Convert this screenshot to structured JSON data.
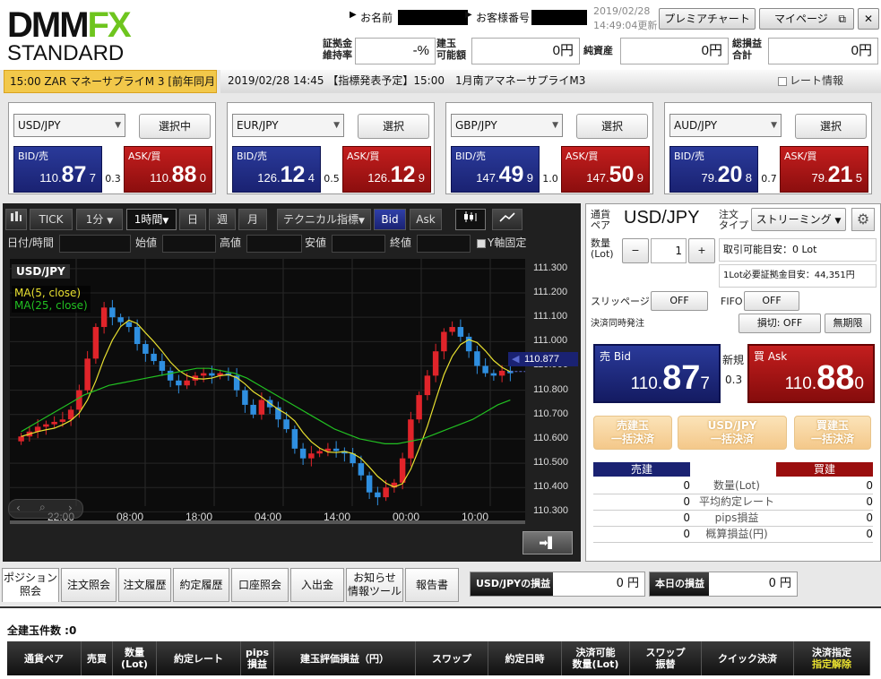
{
  "header": {
    "logo_main": "DMM",
    "logo_accent": "FX",
    "logo_sub": "STANDARD",
    "name_label": "お名前",
    "customer_no_label": "お客様番号",
    "updated_date": "2019/02/28",
    "updated_time": "14:49:04更新",
    "premier_chart": "プレミアチャート",
    "mypage": "マイページ",
    "close": "✕",
    "margin_ratio_label": "証拠金\n維持率",
    "margin_ratio_value": "-%",
    "available_label": "建玉\n可能額",
    "available_value": "0円",
    "net_assets_label": "純資産",
    "net_assets_value": "0円",
    "total_pl_label": "総損益\n合計",
    "total_pl_value": "0円"
  },
  "ticker": {
    "left_text": "15:00  ZAR  マネーサプライM 3 [前年同月",
    "right_text": "2019/02/28 14:45 【指標発表予定】15:00　1月南アマネーサプライM3",
    "rate_info_label": "レート情報"
  },
  "rate_panels": [
    {
      "pair": "USD/JPY",
      "button": "選択中",
      "bid_label": "BID/売",
      "ask_label": "ASK/買",
      "bid_a": "110.",
      "bid_b": "87",
      "bid_c": "7",
      "ask_a": "110.",
      "ask_b": "88",
      "ask_c": "0",
      "spread": "0.3"
    },
    {
      "pair": "EUR/JPY",
      "button": "選択",
      "bid_label": "BID/売",
      "ask_label": "ASK/買",
      "bid_a": "126.",
      "bid_b": "12",
      "bid_c": "4",
      "ask_a": "126.",
      "ask_b": "12",
      "ask_c": "9",
      "spread": "0.5"
    },
    {
      "pair": "GBP/JPY",
      "button": "選択",
      "bid_label": "BID/売",
      "ask_label": "ASK/買",
      "bid_a": "147.",
      "bid_b": "49",
      "bid_c": "9",
      "ask_a": "147.",
      "ask_b": "50",
      "ask_c": "9",
      "spread": "1.0"
    },
    {
      "pair": "AUD/JPY",
      "button": "選択",
      "bid_label": "BID/売",
      "ask_label": "ASK/買",
      "bid_a": "79.",
      "bid_b": "20",
      "bid_c": "8",
      "ask_a": "79.",
      "ask_b": "21",
      "ask_c": "5",
      "spread": "0.7"
    }
  ],
  "chart_toolbar": {
    "tick": "TICK",
    "interval1": "1分",
    "interval2": "1時間",
    "day": "日",
    "week": "週",
    "month": "月",
    "technical": "テクニカル指標",
    "bid": "Bid",
    "ask": "Ask"
  },
  "chart_inputs": {
    "datetime": "日付/時間",
    "open": "始値",
    "high": "高値",
    "low": "安値",
    "close": "終値",
    "yfix": "Y軸固定"
  },
  "chart_data": {
    "type": "candlestick",
    "pair_label": "USD/JPY",
    "ma5_label": "MA(5, close)",
    "ma25_label": "MA(25, close)",
    "current_price": "110.877",
    "ylim": [
      110.25,
      111.34
    ],
    "yticks": [
      "111.300",
      "111.200",
      "111.100",
      "111.000",
      "110.900",
      "110.800",
      "110.700",
      "110.600",
      "110.500",
      "110.400",
      "110.300"
    ],
    "xticks": [
      "22:00",
      "08:00",
      "18:00",
      "04:00",
      "14:00",
      "00:00",
      "10:00"
    ],
    "colors": {
      "up": "#e0242a",
      "down": "#2f8fe0",
      "ma5": "#e8e030",
      "ma25": "#22c022"
    },
    "closes": [
      110.61,
      110.63,
      110.65,
      110.66,
      110.67,
      110.68,
      110.72,
      110.8,
      110.93,
      111.06,
      111.14,
      111.1,
      111.08,
      111.06,
      110.99,
      110.95,
      110.92,
      110.88,
      110.84,
      110.82,
      110.84,
      110.86,
      110.87,
      110.86,
      110.87,
      110.86,
      110.8,
      110.74,
      110.7,
      110.76,
      110.73,
      110.68,
      110.64,
      110.56,
      110.52,
      110.54,
      110.55,
      110.56,
      110.55,
      110.54,
      110.5,
      110.45,
      110.38,
      110.36,
      110.4,
      110.42,
      110.52,
      110.68,
      110.78,
      110.86,
      110.96,
      111.04,
      111.06,
      111.02,
      110.96,
      110.9,
      110.87,
      110.86,
      110.88,
      110.87
    ],
    "ma25": [
      110.63,
      110.66,
      110.69,
      110.72,
      110.75,
      110.78,
      110.8,
      110.82,
      110.83,
      110.84,
      110.85,
      110.86,
      110.87,
      110.88,
      110.89,
      110.89,
      110.88,
      110.87,
      110.85,
      110.82,
      110.79,
      110.76,
      110.73,
      110.7,
      110.67,
      110.64,
      110.62,
      110.6,
      110.59,
      110.58,
      110.58,
      110.59,
      110.6,
      110.62,
      110.64,
      110.66,
      110.68,
      110.71,
      110.74,
      110.76
    ]
  },
  "order": {
    "pair_label": "通貨\nペア",
    "pair": "USD/JPY",
    "type_label": "注文\nタイプ",
    "type_value": "ストリーミング",
    "qty_label": "数量\n(Lot)",
    "minus": "−",
    "qty": "1",
    "plus": "+",
    "tradable": "取引可能目安：0 Lot",
    "required_margin": "1Lot必要証拠金目安：44,351円",
    "slippage_label": "スリッページ",
    "slippage_value": "OFF",
    "fifo_label": "FIFO",
    "fifo_value": "OFF",
    "close_order_label": "決済同時発注",
    "stoploss": "損切: OFF",
    "unlimited": "無期限",
    "bid_label": "売 Bid",
    "bid_a": "110.",
    "bid_b": "87",
    "bid_c": "7",
    "new_label": "新規",
    "spread": "0.3",
    "ask_label": "買 Ask",
    "ask_a": "110.",
    "ask_b": "88",
    "ask_c": "0",
    "bulk_sell_1": "売建玉",
    "bulk_sell_2": "一括決済",
    "bulk_pair_1": "USD/JPY",
    "bulk_pair_2": "一括決済",
    "bulk_buy_1": "買建玉",
    "bulk_buy_2": "一括決済",
    "sell_header": "売建",
    "buy_header": "買建",
    "rows": [
      {
        "label": "数量(Lot)",
        "sell": "0",
        "buy": "0"
      },
      {
        "label": "平均約定レート",
        "sell": "0",
        "buy": "0"
      },
      {
        "label": "pips損益",
        "sell": "0",
        "buy": "0"
      },
      {
        "label": "概算損益(円)",
        "sell": "0",
        "buy": "0"
      }
    ]
  },
  "bottom_tabs": [
    "ポジション\n照会",
    "注文照会",
    "注文履歴",
    "約定履歴",
    "口座照会",
    "入出金",
    "お知らせ\n情報ツール",
    "報告書"
  ],
  "pl_summary": {
    "pair_pl_label": "USD/JPYの損益",
    "pair_pl_value": "0 円",
    "today_pl_label": "本日の損益",
    "today_pl_value": "0 円"
  },
  "positions": {
    "count_label": "全建玉件数 :0",
    "columns": [
      "通貨ペア",
      "売買",
      "数量\n(Lot)",
      "約定レート",
      "pips\n損益",
      "建玉評価損益（円）",
      "スワップ",
      "約定日時",
      "決済可能\n数量(Lot)",
      "スワップ\n振替",
      "クイック決済",
      "決済指定"
    ],
    "last_col_sub": "指定解除"
  }
}
